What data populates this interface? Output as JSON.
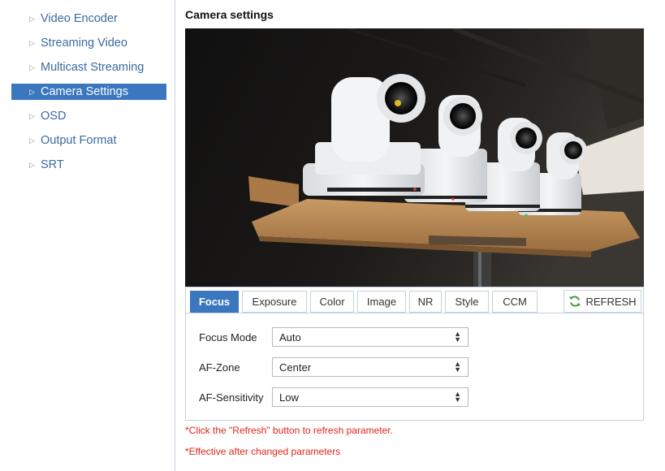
{
  "sidebar": {
    "items": [
      {
        "label": "Video Encoder",
        "active": false
      },
      {
        "label": "Streaming Video",
        "active": false
      },
      {
        "label": "Multicast Streaming",
        "active": false
      },
      {
        "label": "Camera Settings",
        "active": true
      },
      {
        "label": "OSD",
        "active": false
      },
      {
        "label": "Output Format",
        "active": false
      },
      {
        "label": "SRT",
        "active": false
      }
    ]
  },
  "main": {
    "title": "Camera settings",
    "tabs": [
      {
        "label": "Focus",
        "active": true
      },
      {
        "label": "Exposure",
        "active": false
      },
      {
        "label": "Color",
        "active": false
      },
      {
        "label": "Image",
        "active": false
      },
      {
        "label": "NR",
        "active": false
      },
      {
        "label": "Style",
        "active": false
      },
      {
        "label": "CCM",
        "active": false
      }
    ],
    "refresh_label": "REFRESH",
    "fields": [
      {
        "label": "Focus Mode",
        "value": "Auto"
      },
      {
        "label": "AF-Zone",
        "value": "Center"
      },
      {
        "label": "AF-Sensitivity",
        "value": "Low"
      }
    ],
    "notes": [
      "*Click the \"Refresh\" button to refresh parameter.",
      "*Effective after changed parameters"
    ]
  },
  "colors": {
    "accent": "#3a77bf",
    "link": "#3b6aa0",
    "note": "#e0261c",
    "refresh_icon": "#4a9a3a"
  },
  "icons": {
    "nav_bullet": "triangle-right-icon",
    "refresh": "refresh-icon",
    "select_arrows": "sort-arrows-icon"
  }
}
